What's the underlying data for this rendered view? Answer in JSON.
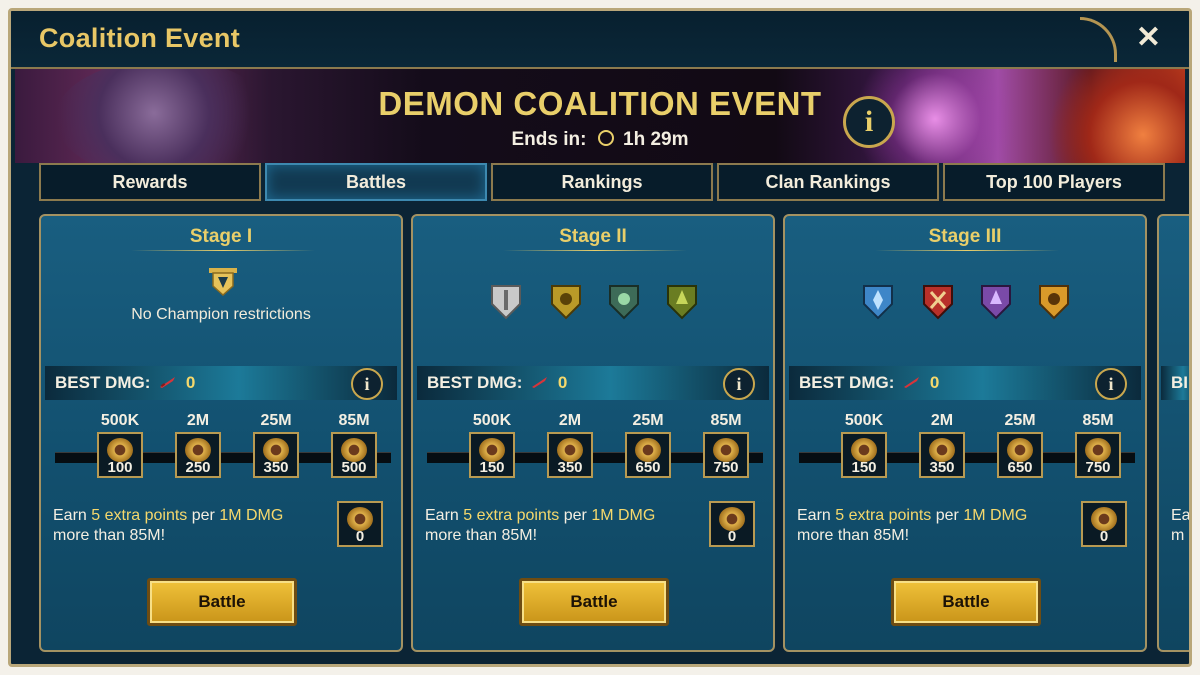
{
  "window": {
    "title": "Coalition Event",
    "close_label": "✕"
  },
  "banner": {
    "event_title": "DEMON COALITION EVENT",
    "ends_label": "Ends in:",
    "ends_time": "1h 29m",
    "info_label": "i"
  },
  "tabs": [
    {
      "label": "Rewards",
      "active": false
    },
    {
      "label": "Battles",
      "active": true
    },
    {
      "label": "Rankings",
      "active": false
    },
    {
      "label": "Clan Rankings",
      "active": false
    },
    {
      "label": "Top 100 Players",
      "active": false
    }
  ],
  "stages": [
    {
      "title": "Stage I",
      "restriction": "No Champion restrictions",
      "factions": [],
      "best_label": "BEST DMG:",
      "best_value": "0",
      "milestones": [
        {
          "threshold": "500K",
          "points": "100"
        },
        {
          "threshold": "2M",
          "points": "250"
        },
        {
          "threshold": "25M",
          "points": "350"
        },
        {
          "threshold": "85M",
          "points": "500"
        }
      ],
      "extra": {
        "pre": "Earn ",
        "points": "5 extra points",
        "mid": " per ",
        "dmg": "1M DMG",
        "post": "more than 85M!",
        "value": "0"
      },
      "battle_label": "Battle"
    },
    {
      "title": "Stage II",
      "restriction": "",
      "factions": [
        {
          "icon": "silver-faction-icon",
          "color": "#c9c9c9"
        },
        {
          "icon": "gold-beast-faction-icon",
          "color": "#b99a28"
        },
        {
          "icon": "green-skull-faction-icon",
          "color": "#3d6b58"
        },
        {
          "icon": "green-tree-faction-icon",
          "color": "#6a7d22"
        }
      ],
      "best_label": "BEST DMG:",
      "best_value": "0",
      "milestones": [
        {
          "threshold": "500K",
          "points": "150"
        },
        {
          "threshold": "2M",
          "points": "350"
        },
        {
          "threshold": "25M",
          "points": "650"
        },
        {
          "threshold": "85M",
          "points": "750"
        }
      ],
      "extra": {
        "pre": "Earn ",
        "points": "5 extra points",
        "mid": " per ",
        "dmg": "1M DMG",
        "post": "more than 85M!",
        "value": "0"
      },
      "battle_label": "Battle"
    },
    {
      "title": "Stage III",
      "restriction": "",
      "factions": [
        {
          "icon": "blue-faction-icon",
          "color": "#3e86c8"
        },
        {
          "icon": "red-faction-icon",
          "color": "#b8302a"
        },
        {
          "icon": "purple-faction-icon",
          "color": "#7a4aa8"
        },
        {
          "icon": "orange-faction-icon",
          "color": "#d99a2a"
        }
      ],
      "best_label": "BEST DMG:",
      "best_value": "0",
      "milestones": [
        {
          "threshold": "500K",
          "points": "150"
        },
        {
          "threshold": "2M",
          "points": "350"
        },
        {
          "threshold": "25M",
          "points": "650"
        },
        {
          "threshold": "85M",
          "points": "750"
        }
      ],
      "extra": {
        "pre": "Earn ",
        "points": "5 extra points",
        "mid": " per ",
        "dmg": "1M DMG",
        "post": "more than 85M!",
        "value": "0"
      },
      "battle_label": "Battle"
    }
  ],
  "partial_card": {
    "best_peek": "BI",
    "line1_peek": "Ea",
    "line2_peek": "m"
  }
}
